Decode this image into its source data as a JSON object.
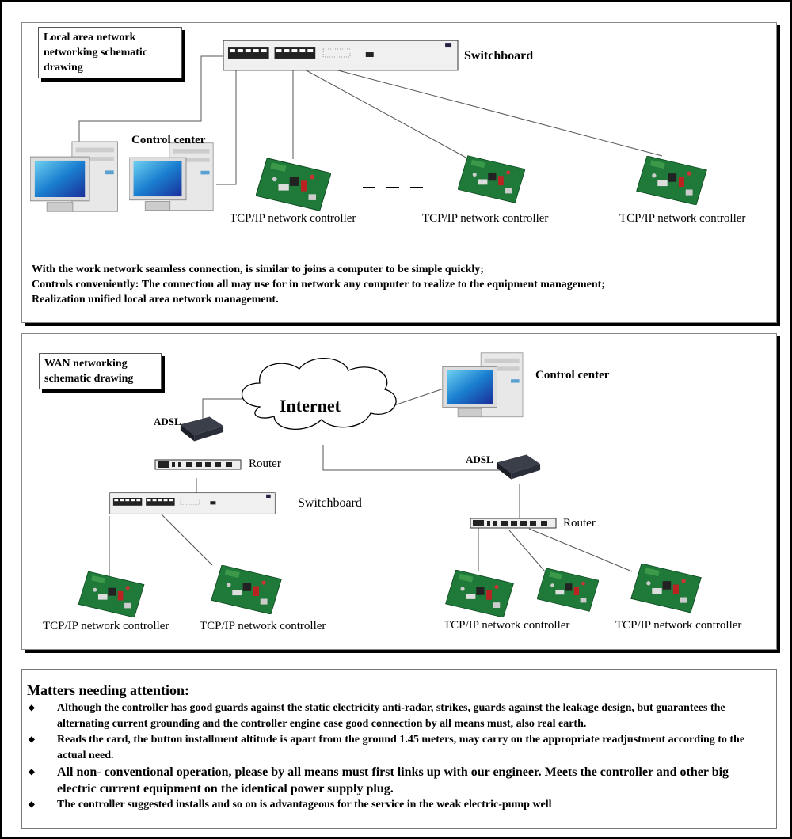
{
  "lan": {
    "title": "Local area network networking schematic drawing",
    "switch_label": "Switchboard",
    "control_center_label": "Control center",
    "controller_labels": [
      "TCP/IP network controller",
      "TCP/IP network controller",
      "TCP/IP network controller"
    ],
    "description": [
      "With the work network seamless connection, is similar to joins a computer to be simple quickly;",
      "Controls conveniently: The connection all may use for in network any computer to realize to the equipment management;",
      "Realization unified local area network management."
    ]
  },
  "wan": {
    "title": "WAN networking schematic drawing",
    "internet_label": "Internet",
    "control_center_label": "Control center",
    "adsl_left": "ADSL",
    "adsl_right": "ADSL",
    "router_left": "Router",
    "router_right": "Router",
    "switch_label": "Switchboard",
    "controller_labels": [
      "TCP/IP network controller",
      "TCP/IP network controller",
      "TCP/IP network controller",
      "TCP/IP network controller"
    ]
  },
  "notes": {
    "title": "Matters needing attention:",
    "bullet_icon": "diamond-bullet",
    "items": [
      "Although the controller has good guards against the static electricity anti-radar, strikes, guards against the leakage design, but guarantees the alternating current grounding and the controller engine case good connection by all means must, also real earth.",
      "Reads the card, the button installment altitude is apart from the ground 1.45 meters, may carry on the appropriate readjustment according to the actual need.",
      "All non- conventional operation, please by all means must first links up with our engineer. Meets the controller and other big electric current equipment on the identical power supply plug.",
      "The controller suggested installs and so on is advantageous for the service in the weak electric-pump well"
    ]
  }
}
